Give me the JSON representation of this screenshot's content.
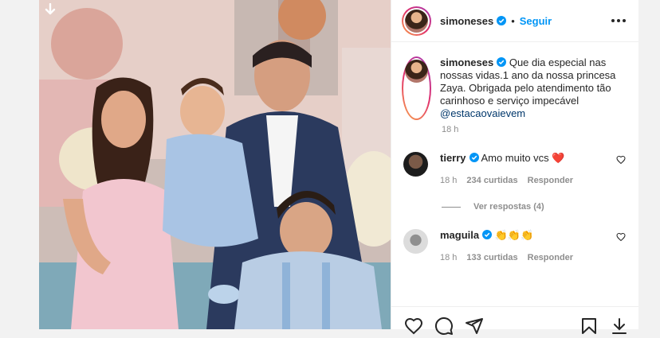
{
  "post": {
    "username": "simoneses",
    "follow_label": "Seguir",
    "dot": "•",
    "caption_text": "Que dia especial nas nossas vidas.1 ano da nossa princesa Zaya. Obrigada pelo atendimento tão carinhoso e serviço impecável",
    "caption_mention": "@estacaovaievem",
    "time": "18 h"
  },
  "comments": [
    {
      "username": "tierry",
      "text": "Amo muito vcs",
      "emoji": "❤️",
      "time": "18 h",
      "likes": "234 curtidas",
      "reply_label": "Responder",
      "avatar_color": "#2a2a2a",
      "view_replies": "Ver respostas (4)"
    },
    {
      "username": "maguila",
      "text": "",
      "emoji": "👏👏👏",
      "time": "18 h",
      "likes": "133 curtidas",
      "reply_label": "Responder",
      "avatar_color": "#c9c9c9"
    }
  ],
  "colors": {
    "link": "#0095f6",
    "mention": "#00376b",
    "verified": "#0095f6",
    "muted": "#8e8e8e"
  },
  "icons": [
    "download-icon",
    "verified-icon",
    "more-options-icon",
    "heart-icon",
    "comment-icon",
    "share-icon",
    "bookmark-icon"
  ]
}
